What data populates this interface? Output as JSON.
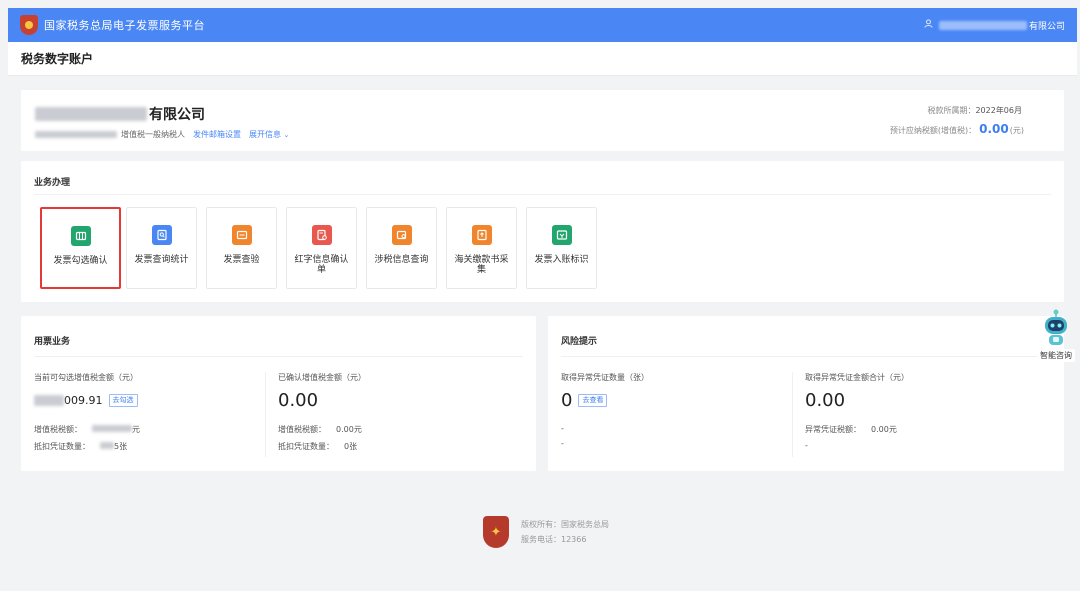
{
  "header": {
    "platform_title": "国家税务总局电子发票服务平台",
    "user_suffix": "有限公司"
  },
  "subheader": {
    "title": "税务数字账户"
  },
  "company": {
    "name_suffix": "有限公司",
    "taxpayer_type": "增值税一般纳税人",
    "email_link": "发件邮箱设置",
    "expand_link": "展开信息",
    "period_label": "税款所属期：",
    "period_value": "2022年06月",
    "estimate_label": "预计应纳税额(增值税)：",
    "estimate_value": "0.00",
    "estimate_unit": "(元)"
  },
  "business": {
    "title": "业务办理",
    "tiles": [
      {
        "label": "发票勾选确认",
        "color": "#22a66e",
        "icon": "ticket-icon"
      },
      {
        "label": "发票查询统计",
        "color": "#4a87f5",
        "icon": "search-doc-icon"
      },
      {
        "label": "发票查验",
        "color": "#f0852d",
        "icon": "scan-icon"
      },
      {
        "label": "红字信息确认单",
        "color": "#e8584f",
        "icon": "doc-edit-icon"
      },
      {
        "label": "涉税信息查询",
        "color": "#f0852d",
        "icon": "search-card-icon"
      },
      {
        "label": "海关缴款书采集",
        "color": "#f0852d",
        "icon": "upload-doc-icon"
      },
      {
        "label": "发票入账标识",
        "color": "#22a66e",
        "icon": "ledger-icon"
      }
    ]
  },
  "usage": {
    "title": "用票业务",
    "left": {
      "label": "当前可勾选增值税金额（元）",
      "value_suffix": "009.91",
      "badge": "去勾选",
      "tax_label": "增值税税额：",
      "tax_suffix": "元",
      "count_label": "抵扣凭证数量：",
      "count_suffix": "5张"
    },
    "right": {
      "label": "已确认增值税金额（元）",
      "value": "0.00",
      "tax_label": "增值税税额：",
      "tax_value": "0.00元",
      "count_label": "抵扣凭证数量：",
      "count_value": "0张"
    }
  },
  "risk": {
    "title": "风险提示",
    "left": {
      "label": "取得异常凭证数量（张）",
      "value": "0",
      "badge": "去查看",
      "line1": "-",
      "line2": "-"
    },
    "right": {
      "label": "取得异常凭证金额合计（元）",
      "value": "0.00",
      "tax_label": "异常凭证税额：",
      "tax_value": "0.00元",
      "line2": "-"
    }
  },
  "footer": {
    "copyright": "版权所有：国家税务总局",
    "hotline": "服务电话：12366"
  },
  "assistant": {
    "label": "智能咨询"
  }
}
